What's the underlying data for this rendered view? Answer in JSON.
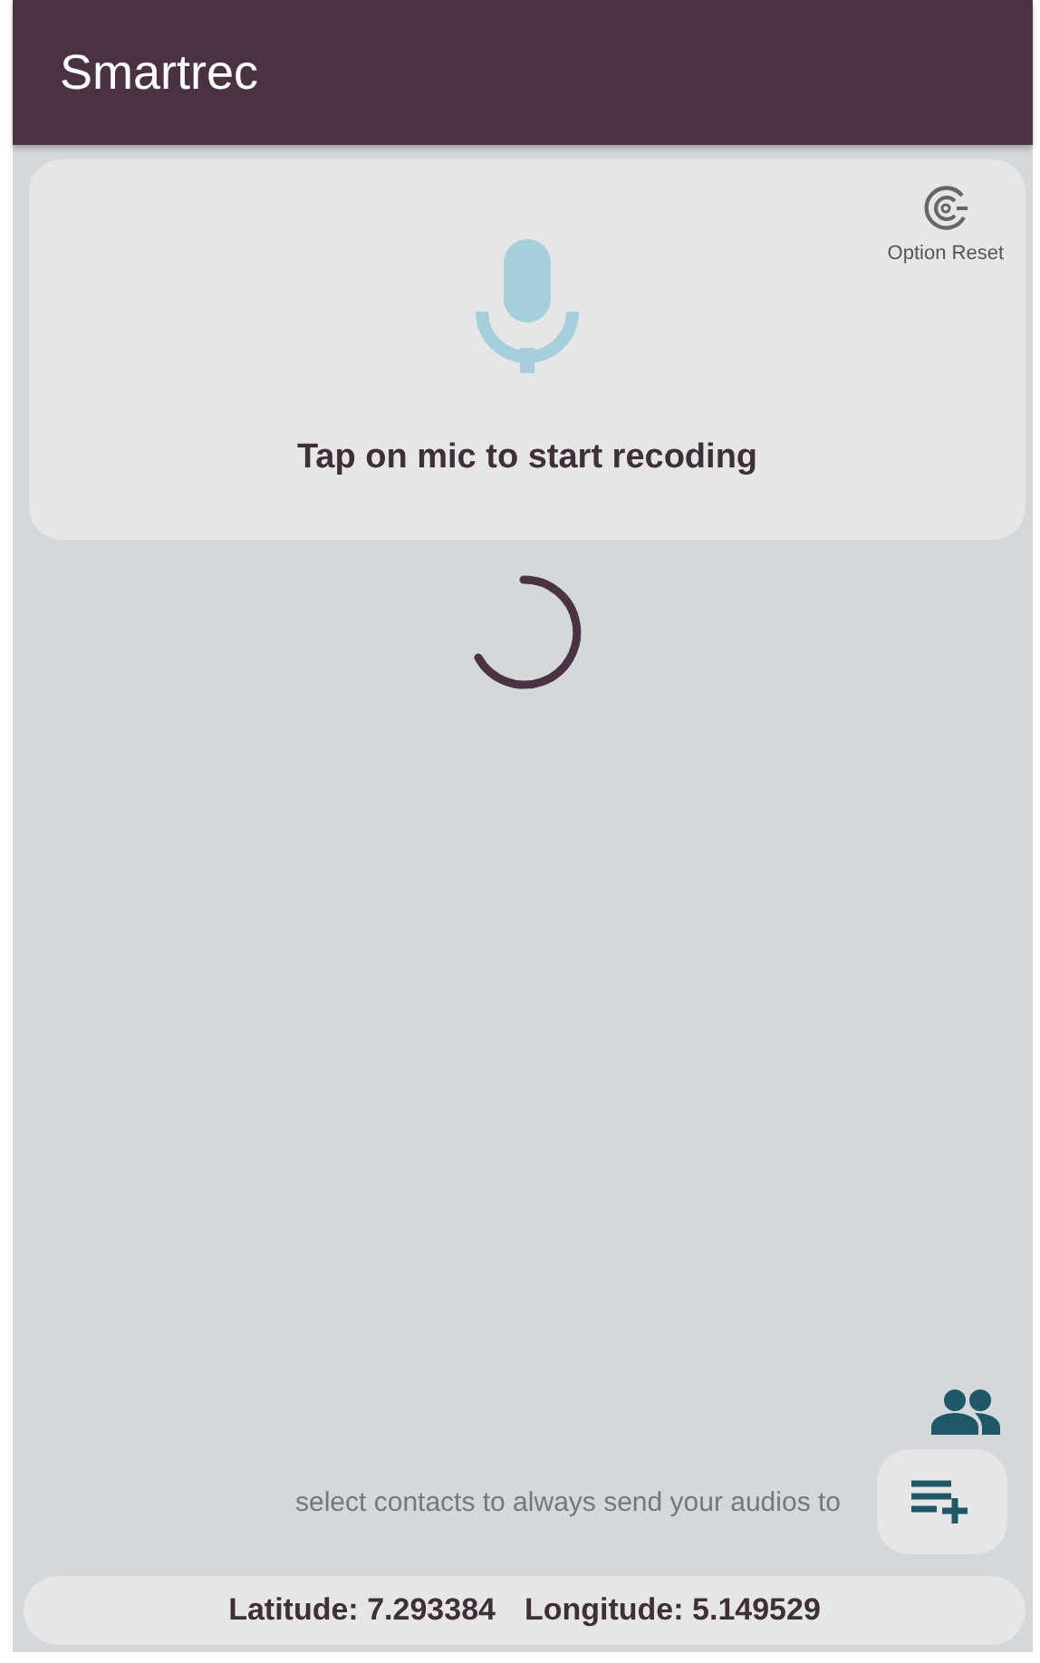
{
  "app_bar": {
    "title": "Smartrec"
  },
  "record_card": {
    "reset_label": "Option Reset",
    "prompt": "Tap on mic to start recoding"
  },
  "contacts": {
    "hint": "select contacts to always send your audios to"
  },
  "location": {
    "latitude": "Latitude: 7.293384",
    "longitude": "Longitude: 5.149529"
  }
}
